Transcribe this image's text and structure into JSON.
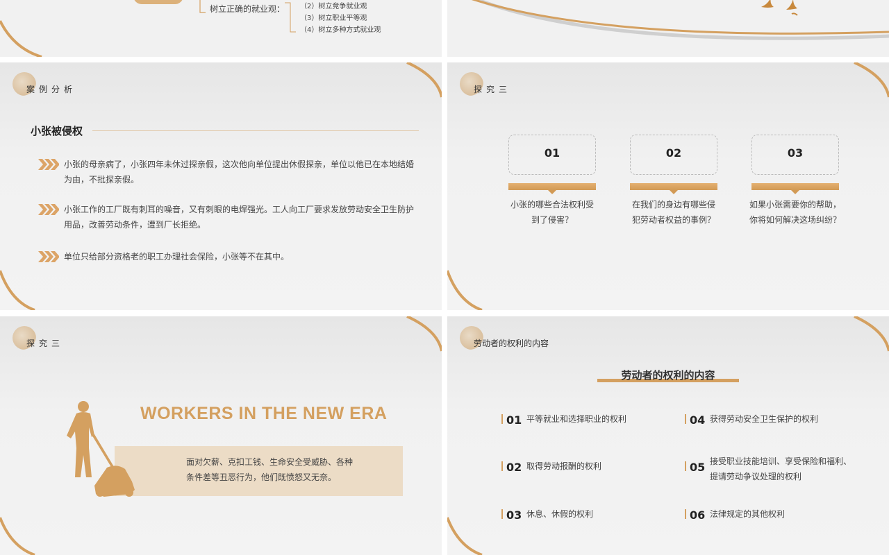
{
  "slide1": {
    "left_label": "树立正确的就业观：",
    "items": [
      "（2）树立竞争就业观",
      "（3）树立职业平等观",
      "（4）树立多种方式就业观"
    ]
  },
  "slide3": {
    "section": "案例分析",
    "title": "小张被侵权",
    "cases": [
      "小张的母亲病了，小张四年未休过探亲假，这次他向单位提出休假探亲，单位以他已在本地结婚为由，不批探亲假。",
      "小张工作的工厂既有刺耳的噪音，又有刺眼的电焊强光。工人向工厂要求发放劳动安全卫生防护用品，改善劳动条件，遭到厂长拒绝。",
      "单位只给部分资格老的职工办理社会保险，小张等不在其中。"
    ]
  },
  "slide4": {
    "section": "探究三",
    "cards": [
      {
        "num": "01",
        "line1": "小张的哪些合法权利受",
        "line2": "到了侵害？"
      },
      {
        "num": "02",
        "line1": "在我们的身边有哪些侵",
        "line2": "犯劳动者权益的事例？"
      },
      {
        "num": "03",
        "line1": "如果小张需要你的帮助，",
        "line2": "你将如何解决这场纠纷？"
      }
    ]
  },
  "slide5": {
    "section": "探究三",
    "headline": "WORKERS IN THE NEW ERA",
    "line1": "面对欠薪、克扣工钱、生命安全受威胁、各种",
    "line2": "条件差等丑恶行为，他们既愤怒又无奈。"
  },
  "slide6": {
    "section": "劳动者的权利的内容",
    "title": "劳动者的权利的内容",
    "rights": [
      {
        "num": "01",
        "text": "平等就业和选择职业的权利"
      },
      {
        "num": "02",
        "text": "取得劳动报酬的权利"
      },
      {
        "num": "03",
        "text": "休息、休假的权利"
      },
      {
        "num": "04",
        "text": "获得劳动安全卫生保护的权利"
      },
      {
        "num": "05",
        "text": "接受职业技能培训、享受保险和福利、",
        "text2": "提请劳动争议处理的权利"
      },
      {
        "num": "06",
        "text": "法律规定的其他权利"
      }
    ]
  },
  "colors": {
    "accent": "#d4a060",
    "accent_dark": "#c8893d",
    "panel": "#ecdcc6"
  }
}
